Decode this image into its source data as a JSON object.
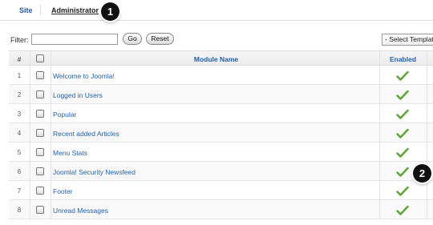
{
  "tabs": {
    "site": "Site",
    "administrator": "Administrator"
  },
  "callouts": [
    "1",
    "2"
  ],
  "filter": {
    "label": "Filter:",
    "value": "",
    "go": "Go",
    "reset": "Reset",
    "template_select": "- Select Template -"
  },
  "table": {
    "headers": {
      "num": "#",
      "name": "Module Name",
      "enabled": "Enabled"
    },
    "rows": [
      {
        "num": "1",
        "name": "Welcome to Joomla!",
        "enabled": true
      },
      {
        "num": "2",
        "name": "Logged in Users",
        "enabled": true
      },
      {
        "num": "3",
        "name": "Popular",
        "enabled": true
      },
      {
        "num": "4",
        "name": "Recent added Articles",
        "enabled": true
      },
      {
        "num": "5",
        "name": "Menu Stats",
        "enabled": true
      },
      {
        "num": "6",
        "name": "Joomla! Security Newsfeed",
        "enabled": true
      },
      {
        "num": "7",
        "name": "Footer",
        "enabled": true
      },
      {
        "num": "8",
        "name": "Unread Messages",
        "enabled": true
      }
    ]
  },
  "colors": {
    "link": "#1f5fb4",
    "check": "#5aa632"
  }
}
